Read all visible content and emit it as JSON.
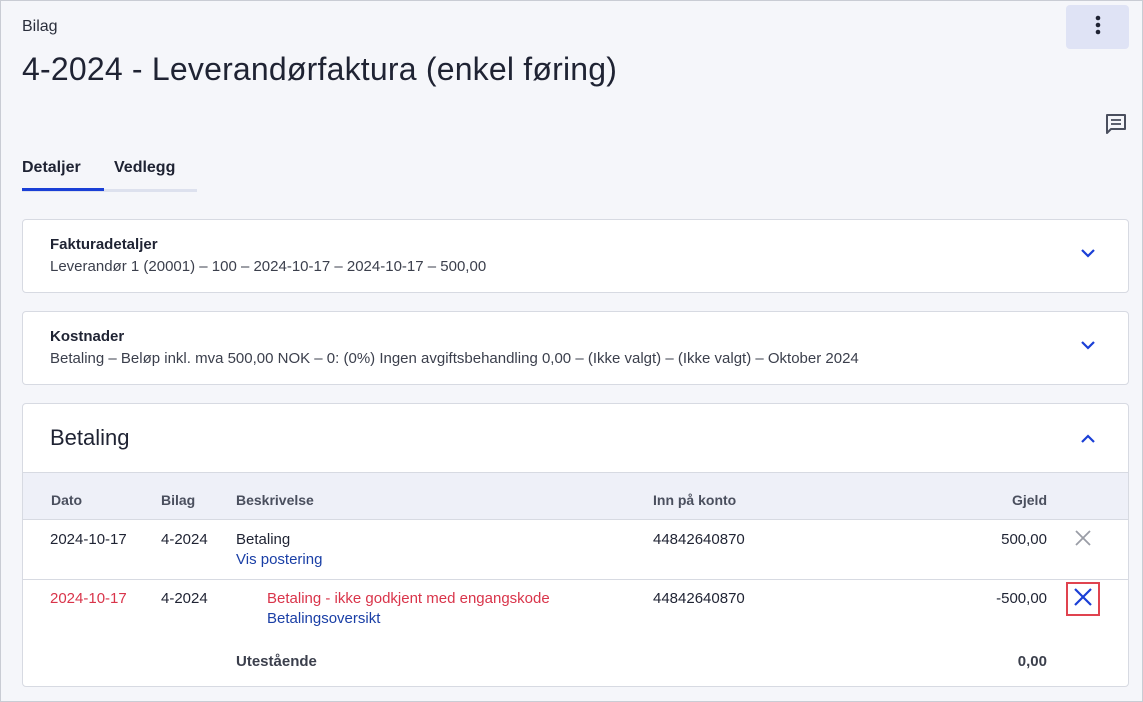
{
  "header": {
    "breadcrumb": "Bilag",
    "title": "4-2024 - Leverandørfaktura (enkel føring)",
    "more_icon": "more-vertical-icon",
    "comment_icon": "comment-icon"
  },
  "tabs": [
    {
      "label": "Detaljer",
      "active": true
    },
    {
      "label": "Vedlegg",
      "active": false
    }
  ],
  "invoice_details": {
    "title": "Fakturadetaljer",
    "summary": "Leverandør 1 (20001) – 100 – 2024-10-17 – 2024-10-17 – 500,00"
  },
  "costs": {
    "title": "Kostnader",
    "summary": "Betaling – Beløp inkl. mva 500,00 NOK – 0: (0%) Ingen avgiftsbehandling 0,00 – (Ikke valgt) – (Ikke valgt) – Oktober 2024"
  },
  "payment": {
    "title": "Betaling",
    "columns": [
      "Dato",
      "Bilag",
      "Beskrivelse",
      "Inn på konto",
      "Gjeld"
    ],
    "rows": [
      {
        "date": "2024-10-17",
        "voucher": "4-2024",
        "description": "Betaling",
        "link": "Vis postering",
        "account": "44842640870",
        "amount": "500,00"
      },
      {
        "date": "2024-10-17",
        "voucher": "4-2024",
        "description": "Betaling - ikke godkjent med engangskode",
        "link": "Betalingsoversikt",
        "account": "44842640870",
        "amount": "-500,00"
      }
    ],
    "outstanding_label": "Utestående",
    "outstanding_value": "0,00"
  },
  "colors": {
    "accent": "#1a3fd6",
    "error": "#d9344a",
    "link": "#1a3fa6"
  }
}
